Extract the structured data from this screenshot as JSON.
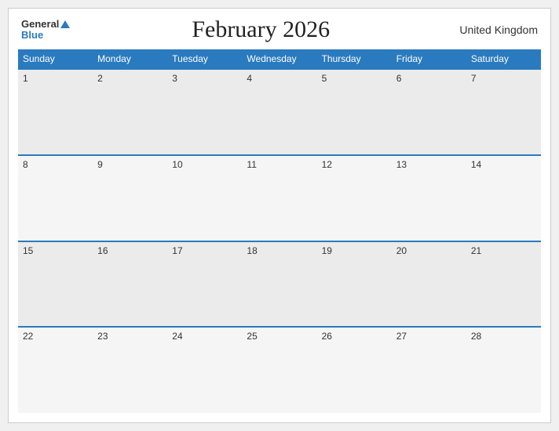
{
  "header": {
    "logo_general": "General",
    "logo_blue": "Blue",
    "month_title": "February 2026",
    "country": "United Kingdom"
  },
  "days_of_week": [
    "Sunday",
    "Monday",
    "Tuesday",
    "Wednesday",
    "Thursday",
    "Friday",
    "Saturday"
  ],
  "weeks": [
    [
      1,
      2,
      3,
      4,
      5,
      6,
      7
    ],
    [
      8,
      9,
      10,
      11,
      12,
      13,
      14
    ],
    [
      15,
      16,
      17,
      18,
      19,
      20,
      21
    ],
    [
      22,
      23,
      24,
      25,
      26,
      27,
      28
    ]
  ]
}
